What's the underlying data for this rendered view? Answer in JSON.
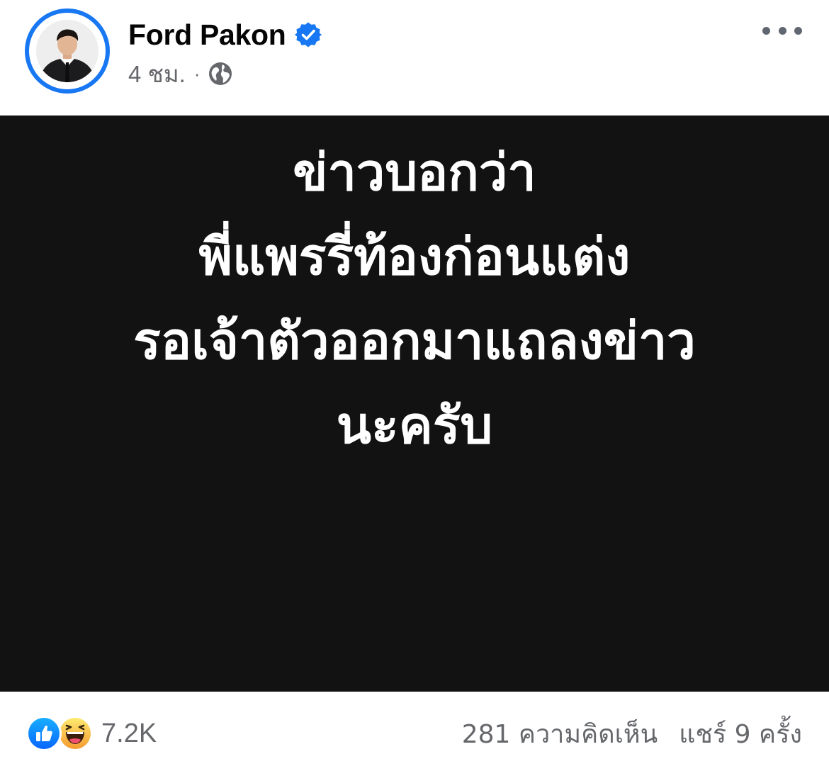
{
  "post": {
    "author_name": "Ford Pakon",
    "verified": true,
    "timestamp": "4 ชม.",
    "separator": "·",
    "audience": "globe-icon",
    "more_icon": "more-horizontal-icon",
    "image_text": {
      "lines": [
        "ข่าวบอกว่า",
        "พี่แพรรี่ท้องก่อนแต่ง",
        "รอเจ้าตัวออกมาแถลงข่าว",
        "นะครับ"
      ]
    }
  },
  "engagement": {
    "reaction_icons": [
      "like-icon",
      "haha-icon"
    ],
    "reaction_count": "7.2K",
    "comments": "281 ความคิดเห็น",
    "shares": "แชร์ 9 ครั้ง"
  },
  "colors": {
    "brand_blue": "#1877f2",
    "secondary_text": "#65676b",
    "image_background": "#121212",
    "image_text": "#ffffff",
    "haha_yellow": "#f7c84b"
  }
}
